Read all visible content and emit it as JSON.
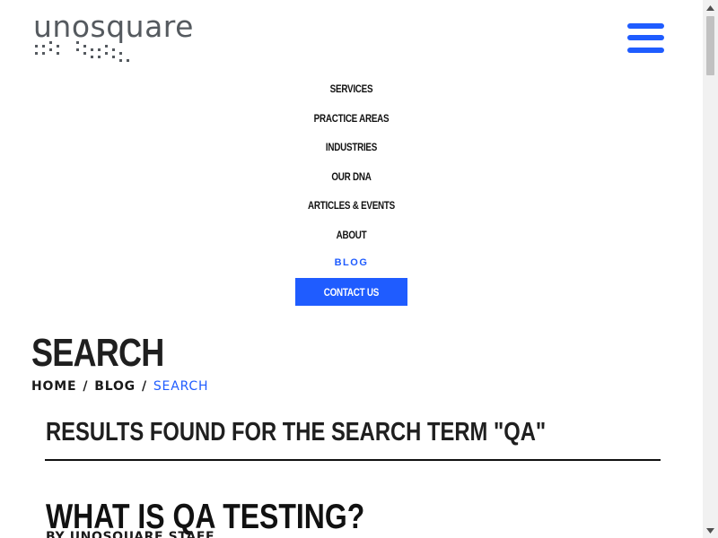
{
  "brand": {
    "logo_text": "unosquare"
  },
  "header": {
    "menu_button_icon": "hamburger-menu-icon",
    "accent_color": "#1f5cff"
  },
  "nav": {
    "items": [
      {
        "label": "SERVICES"
      },
      {
        "label": "PRACTICE AREAS"
      },
      {
        "label": "INDUSTRIES"
      },
      {
        "label": "OUR DNA"
      },
      {
        "label": "ARTICLES & EVENTS"
      },
      {
        "label": "ABOUT"
      },
      {
        "label": "BLOG",
        "active": true
      }
    ],
    "contact_label": "CONTACT US"
  },
  "page": {
    "title": "SEARCH",
    "breadcrumb": {
      "home": "HOME",
      "sep1": "/",
      "blog": "BLOG",
      "sep2": "/",
      "current": "SEARCH"
    }
  },
  "results": {
    "heading": "RESULTS FOUND FOR THE SEARCH TERM \"QA\"",
    "posts": [
      {
        "title": "WHAT IS QA TESTING?",
        "byline": "BY UNOSQUARE STAFF"
      }
    ]
  }
}
